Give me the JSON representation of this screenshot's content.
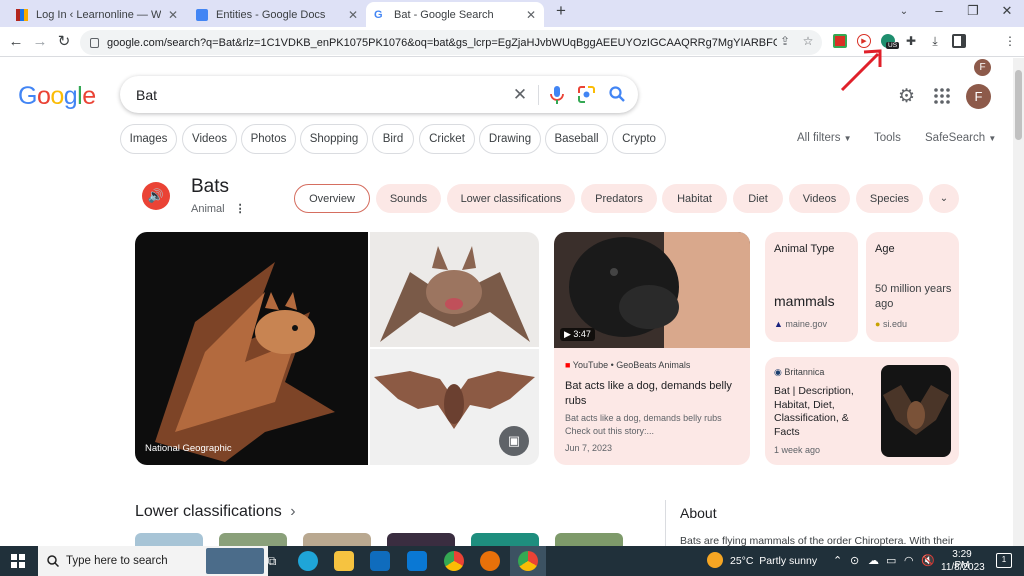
{
  "tabs": [
    {
      "title": "Log In ‹ Learnonline — WordPres",
      "favicon_color": "#2271b1"
    },
    {
      "title": "Entities - Google Docs",
      "favicon_color": "#4285f4"
    },
    {
      "title": "Bat - Google Search",
      "favicon_color": "#4285f4"
    }
  ],
  "new_tab_label": "+",
  "address": {
    "url": "google.com/search?q=Bat&rlz=1C1VDKB_enPK1075PK1076&oq=bat&gs_lcrp=EgZjaHJvbWUqBggAEEUYOzIGCAAQRRg7MgYIARBFGDsyBgg..."
  },
  "extension_badge": "US",
  "profile_initial": "F",
  "google_logo": "Google",
  "search": {
    "value": "Bat",
    "placeholder": ""
  },
  "chips": [
    "Images",
    "Videos",
    "Photos",
    "Shopping",
    "Bird",
    "Cricket",
    "Drawing",
    "Baseball",
    "Crypto"
  ],
  "tools": {
    "all_filters": "All filters",
    "tools": "Tools",
    "safesearch": "SafeSearch"
  },
  "entity": {
    "title": "Bats",
    "subtitle": "Animal"
  },
  "entity_tabs": [
    "Overview",
    "Sounds",
    "Lower classifications",
    "Predators",
    "Habitat",
    "Diet",
    "Videos",
    "Species"
  ],
  "image_credit": "National Geographic",
  "video": {
    "duration": "3:47",
    "source": "YouTube • GeoBeats Animals",
    "title": "Bat acts like a dog, demands belly rubs",
    "snippet": "Bat acts like a dog, demands belly rubs Check out this story:...",
    "date": "Jun 7, 2023"
  },
  "facts": [
    {
      "label": "Animal Type",
      "value": "mammals",
      "source": "maine.gov"
    },
    {
      "label": "Age",
      "value": "50 million years ago",
      "source": "si.edu"
    }
  ],
  "britannica": {
    "source": "Britannica",
    "title": "Bat | Description, Habitat, Diet, Classification, & Facts",
    "age": "1 week ago"
  },
  "lower_classifications": {
    "heading": "Lower classifications",
    "arrow": "›"
  },
  "about": {
    "heading": "About",
    "text": "Bats are flying mammals of the order Chiroptera. With their"
  },
  "taskbar": {
    "search_placeholder": "Type here to search",
    "weather": "25°C  Partly sunny",
    "time": "3:29 PM",
    "date": "11/8/2023",
    "notifications": "1"
  },
  "colors": {
    "accent_chip": "#fce8e6",
    "google_blue": "#4285f4",
    "google_red": "#ea4335",
    "google_yellow": "#fbbc05",
    "google_green": "#34a853"
  }
}
